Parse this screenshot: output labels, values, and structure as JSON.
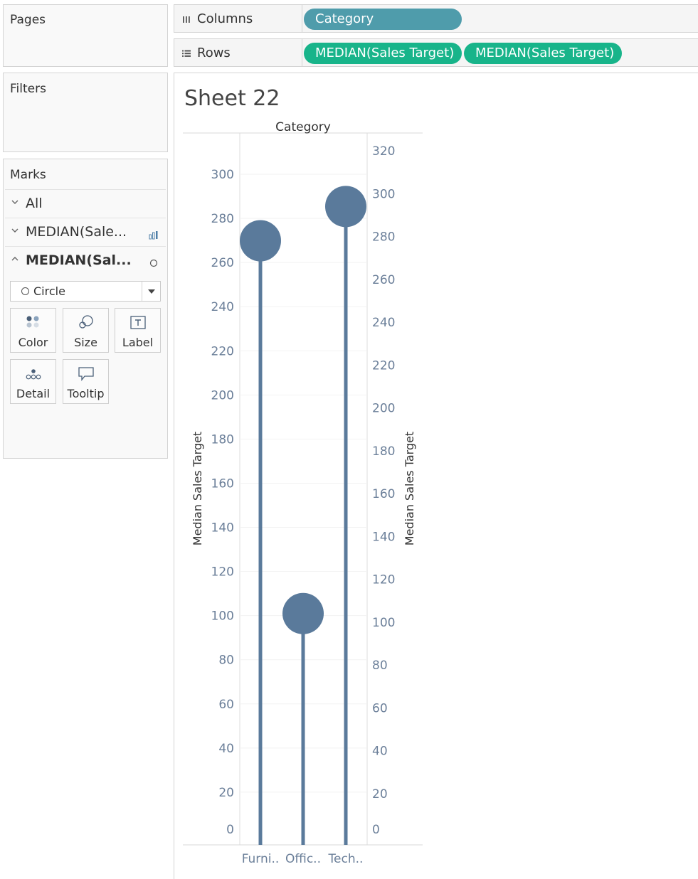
{
  "cards": {
    "pages_title": "Pages",
    "filters_title": "Filters",
    "marks_title": "Marks"
  },
  "marks": {
    "rows": [
      {
        "label": "All",
        "icon": "chevron-down-icon"
      },
      {
        "label": "MEDIAN(Sale...",
        "icon": "chevron-down-icon",
        "type_icon": "bar-chart-icon"
      },
      {
        "label": "MEDIAN(Sal...",
        "icon": "chevron-up-icon",
        "type_icon": "circle-icon"
      }
    ],
    "mark_type": "Circle",
    "buttons": {
      "color": "Color",
      "size": "Size",
      "label": "Label",
      "detail": "Detail",
      "tooltip": "Tooltip"
    }
  },
  "shelves": {
    "columns": {
      "label": "Columns",
      "pills": [
        "Category"
      ]
    },
    "rows": {
      "label": "Rows",
      "pills": [
        "MEDIAN(Sales Target)",
        "MEDIAN(Sales Target)"
      ]
    }
  },
  "colors": {
    "dimension_pill": "#4f9cab",
    "measure_pill": "#18b48a",
    "mark": "#5a7a9b",
    "axis_text": "#6b7f99"
  },
  "sheet": {
    "title": "Sheet 22"
  },
  "chart_data": {
    "type": "scatter",
    "title": "Category",
    "categories": [
      "Furni..",
      "Offic..",
      "Tech.."
    ],
    "series": [
      {
        "name": "MEDIAN(Sales Target)",
        "mark": "bar",
        "values": [
          278,
          104,
          294
        ]
      },
      {
        "name": "MEDIAN(Sales Target)",
        "mark": "circle",
        "values": [
          278,
          104,
          294
        ]
      }
    ],
    "ylabel": "Median Sales Target",
    "y2label": "Median Sales Target",
    "ylim": [
      0,
      320
    ],
    "y2lim": [
      0,
      320
    ],
    "yticks": [
      0,
      20,
      40,
      60,
      80,
      100,
      120,
      140,
      160,
      180,
      200,
      220,
      240,
      260,
      280,
      300
    ],
    "y2ticks": [
      0,
      20,
      40,
      60,
      80,
      100,
      120,
      140,
      160,
      180,
      200,
      220,
      240,
      260,
      280,
      300,
      320
    ],
    "grid": true,
    "dual_axis": true
  }
}
